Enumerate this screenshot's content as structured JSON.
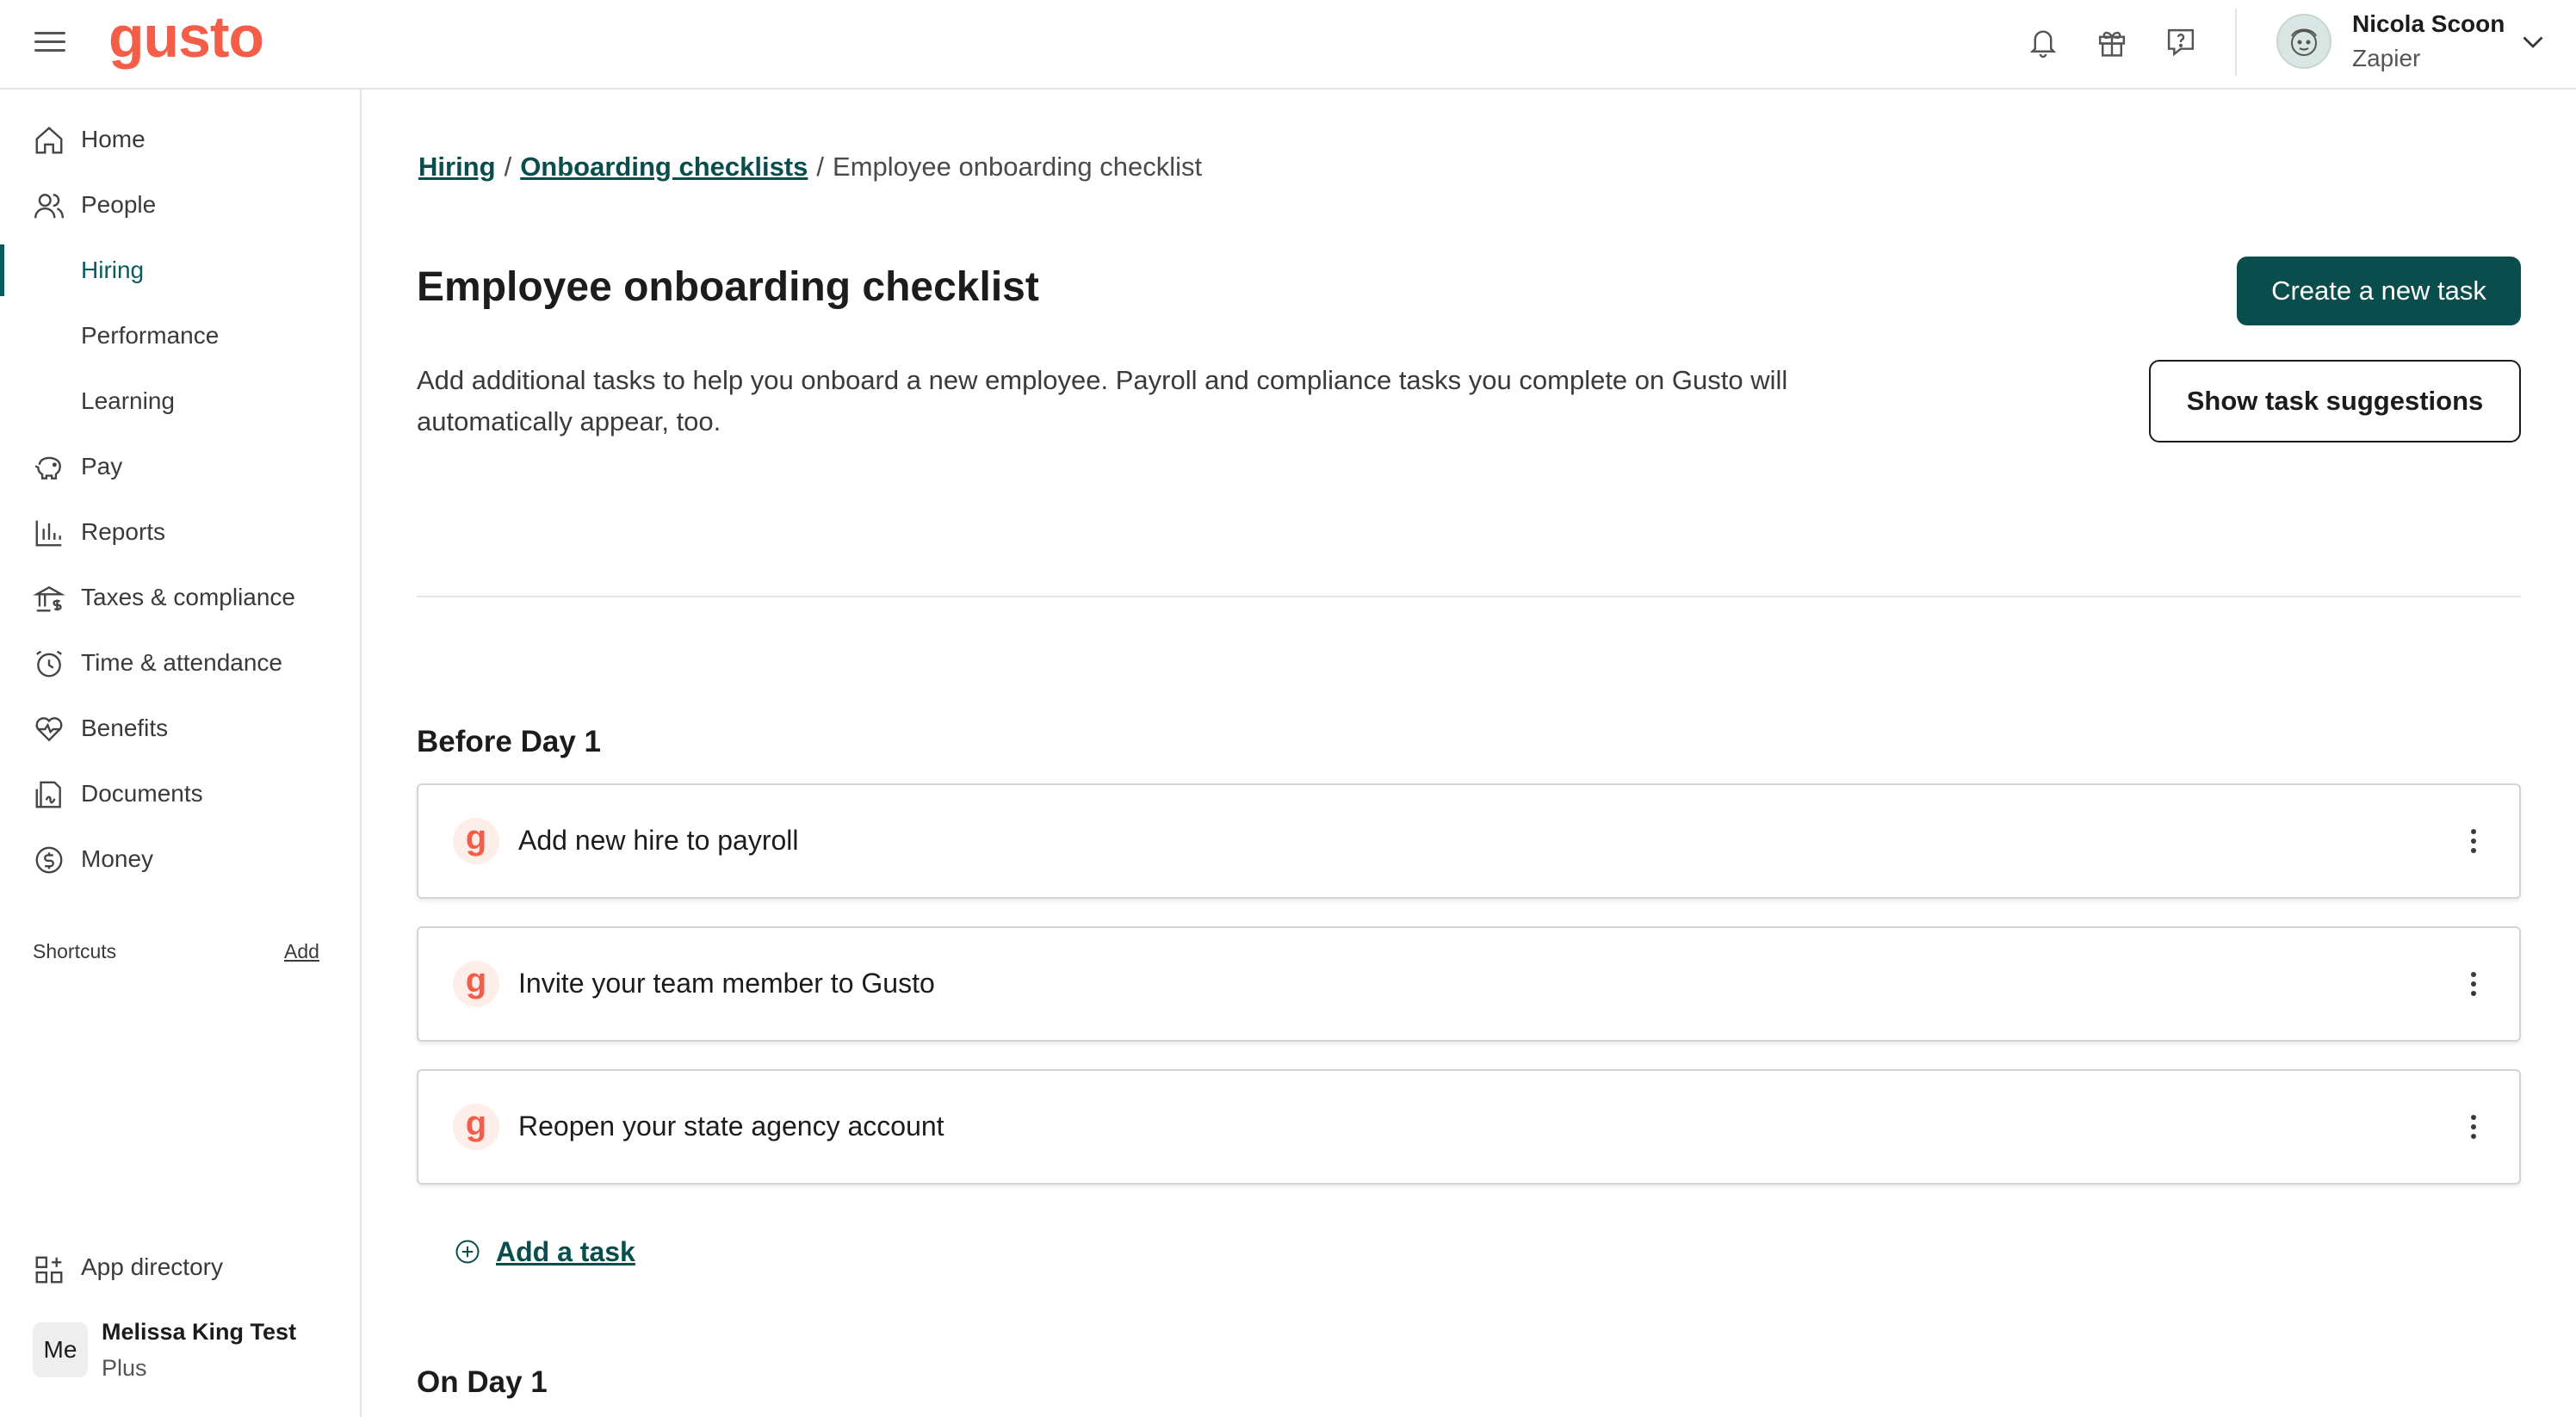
{
  "app": {
    "logo": "gusto"
  },
  "topbar": {
    "icons": [
      "bell-icon",
      "gift-icon",
      "help-icon"
    ],
    "user": {
      "name": "Nicola Scoon",
      "company": "Zapier"
    }
  },
  "sidebar": {
    "items": [
      {
        "label": "Home",
        "icon": "home-icon"
      },
      {
        "label": "People",
        "icon": "people-icon"
      },
      {
        "label": "Hiring",
        "icon": ""
      },
      {
        "label": "Performance",
        "icon": ""
      },
      {
        "label": "Learning",
        "icon": ""
      },
      {
        "label": "Pay",
        "icon": "piggy-bank-icon"
      },
      {
        "label": "Reports",
        "icon": "bar-chart-icon"
      },
      {
        "label": "Taxes & compliance",
        "icon": "bank-icon"
      },
      {
        "label": "Time & attendance",
        "icon": "clock-icon"
      },
      {
        "label": "Benefits",
        "icon": "heart-icon"
      },
      {
        "label": "Documents",
        "icon": "document-icon"
      },
      {
        "label": "Money",
        "icon": "dollar-icon"
      }
    ],
    "shortcuts": {
      "label": "Shortcuts",
      "add": "Add"
    },
    "app_directory": "App directory",
    "account": {
      "initials": "Me",
      "name": "Melissa King Test",
      "plan": "Plus"
    }
  },
  "breadcrumb": {
    "items": [
      "Hiring",
      "Onboarding checklists"
    ],
    "separator": "/",
    "current": "Employee onboarding checklist"
  },
  "main": {
    "title": "Employee onboarding checklist",
    "description": "Add additional tasks to help you onboard a new employee. Payroll and compliance tasks you complete on Gusto will automatically appear, too.",
    "create_button": "Create a new task",
    "suggestions_button": "Show task suggestions",
    "sections": [
      {
        "title": "Before Day 1",
        "tasks": [
          "Add new hire to payroll",
          "Invite your team member to Gusto",
          "Reopen your state agency account"
        ],
        "add_task": "Add a task"
      },
      {
        "title": "On Day 1"
      }
    ],
    "task_badge": "g"
  },
  "colors": {
    "brand": "#f45d48",
    "primary": "#0a4d4d",
    "active_nav": "#0a5c5c"
  }
}
